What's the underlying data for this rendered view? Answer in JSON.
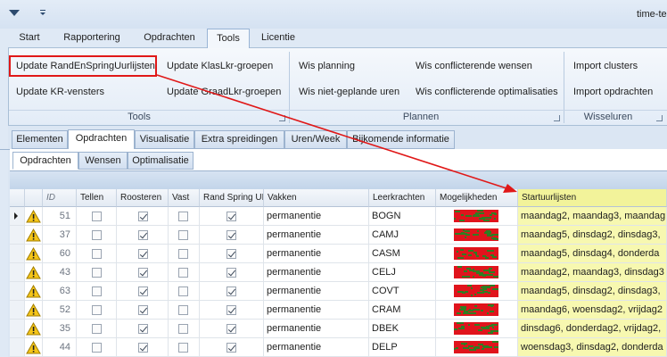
{
  "app": {
    "title": "time-te"
  },
  "ribbon_tabs": [
    "Start",
    "Rapportering",
    "Opdrachten",
    "Tools",
    "Licentie"
  ],
  "ribbon": {
    "tools": {
      "update_randenspring": "Update RandEnSpringUurlijsten",
      "update_klaslkr": "Update KlasLkr-groepen",
      "update_krvensters": "Update KR-vensters",
      "update_graadlkr": "Update GraadLkr-groepen",
      "label": "Tools"
    },
    "plannen": {
      "wis_planning": "Wis planning",
      "wis_conflicterende_wensen": "Wis conflicterende wensen",
      "wis_niet_geplande": "Wis niet-geplande uren",
      "wis_conflicterende_opt": "Wis conflicterende optimalisaties",
      "label": "Plannen"
    },
    "wisseluren": {
      "import_clusters": "Import clusters",
      "import_opdrachten": "Import opdrachten",
      "label": "Wisseluren"
    }
  },
  "tabs": [
    "Elementen",
    "Opdrachten",
    "Visualisatie",
    "Extra spreidingen",
    "Uren/Week",
    "Bijkomende informatie"
  ],
  "subtabs": [
    "Opdrachten",
    "Wensen",
    "Optimalisatie"
  ],
  "grid": {
    "headers": {
      "id": "ID",
      "tellen": "Tellen",
      "roosteren": "Roosteren",
      "vast": "Vast",
      "randspring": "Rand Spring UL",
      "vakken": "Vakken",
      "leerkrachten": "Leerkrachten",
      "mogelijkheden": "Mogelijkheden",
      "startuurlijsten": "Startuurlijsten"
    },
    "rows": [
      {
        "id": "51",
        "vakken": "permanentie",
        "leerkracht": "BOGN",
        "start": "maandag2, maandag3, maandag"
      },
      {
        "id": "37",
        "vakken": "permanentie",
        "leerkracht": "CAMJ",
        "start": "maandag5, dinsdag2, dinsdag3,"
      },
      {
        "id": "60",
        "vakken": "permanentie",
        "leerkracht": "CASM",
        "start": "maandag5, dinsdag4, donderda"
      },
      {
        "id": "43",
        "vakken": "permanentie",
        "leerkracht": "CELJ",
        "start": "maandag2, maandag3, dinsdag3"
      },
      {
        "id": "63",
        "vakken": "permanentie",
        "leerkracht": "COVT",
        "start": "maandag5, dinsdag2, dinsdag3,"
      },
      {
        "id": "52",
        "vakken": "permanentie",
        "leerkracht": "CRAM",
        "start": "maandag6, woensdag2, vrijdag2"
      },
      {
        "id": "35",
        "vakken": "permanentie",
        "leerkracht": "DBEK",
        "start": "dinsdag6, donderdag2, vrijdag2,"
      },
      {
        "id": "44",
        "vakken": "permanentie",
        "leerkracht": "DELP",
        "start": "woensdag3, dinsdag2, donderda"
      }
    ]
  },
  "colors": {
    "accent_red": "#e01818",
    "heat_red": "#e0141c",
    "heat_green": "#2f7d22",
    "highlight_yellow": "#f7f8b0"
  },
  "icons": [
    "qat-dropdown-icon",
    "warning-icon",
    "row-pointer-icon",
    "group-launcher-icon"
  ]
}
